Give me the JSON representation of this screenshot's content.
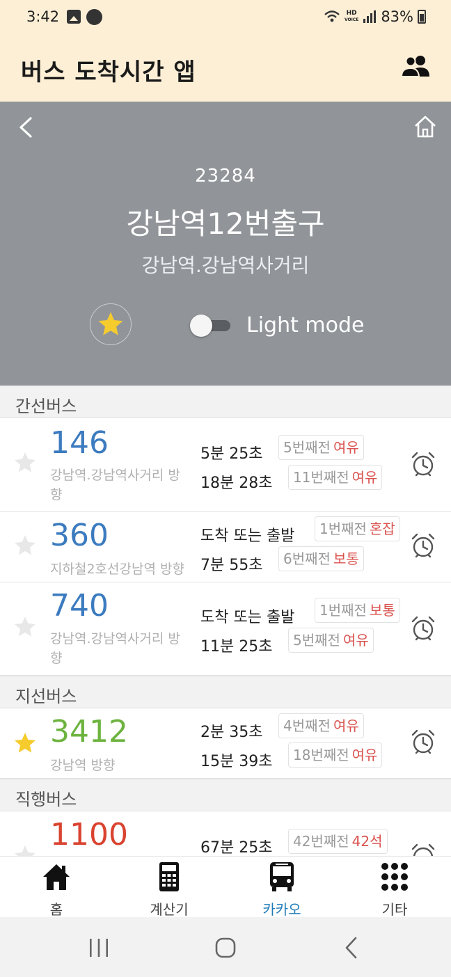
{
  "status_bar": {
    "time": "3:42",
    "battery": "83%",
    "network": "HD VOICE",
    "icons": [
      "image-icon",
      "wecr-app-icon",
      "wifi-icon",
      "signal-icon",
      "battery-icon"
    ]
  },
  "app_bar": {
    "title": "버스 도착시간 앱",
    "icons": [
      "people-icon"
    ]
  },
  "stop": {
    "id": "23284",
    "name": "강남역12번출구",
    "direction": "강남역.강남역사거리",
    "favorite": true,
    "mode_label": "Light mode",
    "mode_on": false
  },
  "colors": {
    "header_bg": "#fdefd6",
    "stop_bg": "#919599",
    "trunk_bus": "#3c7bbf",
    "branch_bus": "#6db33f",
    "express_bus": "#d9432f",
    "crowd_text": "#d9534f",
    "star_active": "#f5cb2e",
    "active_nav": "#1f7bb8"
  },
  "sections": [
    {
      "title": "간선버스",
      "buses": [
        {
          "number": "146",
          "direction": "강남역.강남역사거리 방향",
          "favorite": false,
          "arrivals": [
            {
              "time": "5분 25초",
              "stops": "5번째전",
              "crowd": "여유"
            },
            {
              "time": "18분 28초",
              "stops": "11번째전",
              "crowd": "여유"
            }
          ]
        },
        {
          "number": "360",
          "direction": "지하철2호선강남역 방향",
          "favorite": false,
          "arrivals": [
            {
              "time": "도착 또는 출발",
              "stops": "1번째전",
              "crowd": "혼잡"
            },
            {
              "time": "7분 55초",
              "stops": "6번째전",
              "crowd": "보통"
            }
          ]
        },
        {
          "number": "740",
          "direction": "강남역.강남역사거리 방향",
          "favorite": false,
          "arrivals": [
            {
              "time": "도착 또는 출발",
              "stops": "1번째전",
              "crowd": "보통"
            },
            {
              "time": "11분 25초",
              "stops": "5번째전",
              "crowd": "여유"
            }
          ]
        }
      ]
    },
    {
      "title": "지선버스",
      "buses": [
        {
          "number": "3412",
          "direction": "강남역 방향",
          "favorite": true,
          "arrivals": [
            {
              "time": "2분 35초",
              "stops": "4번째전",
              "crowd": "여유"
            },
            {
              "time": "15분 39초",
              "stops": "18번째전",
              "crowd": "여유"
            }
          ]
        }
      ]
    },
    {
      "title": "직행버스",
      "buses": [
        {
          "number": "1100",
          "favorite": false,
          "arrivals": [
            {
              "time": "67분 25초",
              "stops": "42번째전",
              "crowd": "42석"
            }
          ]
        }
      ]
    }
  ],
  "bottom_nav": [
    {
      "label": "홈",
      "icon": "home-icon",
      "active": false
    },
    {
      "label": "계산기",
      "icon": "calculator-icon",
      "active": false
    },
    {
      "label": "카카오",
      "icon": "bus-icon",
      "active": true
    },
    {
      "label": "기타",
      "icon": "grid-icon",
      "active": false
    }
  ],
  "system_nav": [
    "recent-apps-icon",
    "home-circle-icon",
    "back-icon"
  ]
}
